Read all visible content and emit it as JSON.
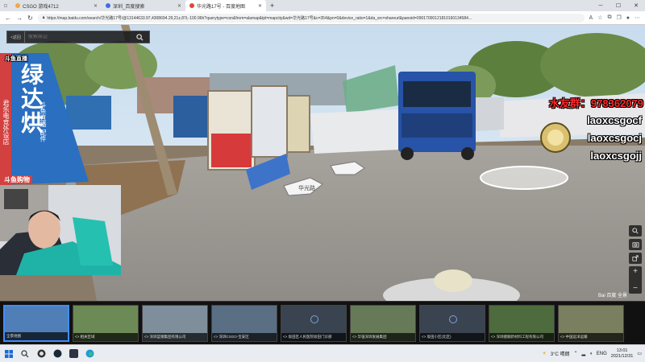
{
  "browser": {
    "tabs": [
      {
        "label": "CSGO 游戏4712",
        "color": "#f2a84a",
        "active": false
      },
      {
        "label": "深圳_百度搜索",
        "color": "#3b6fe0",
        "active": false
      },
      {
        "label": "华光路17号 - 百度地图",
        "color": "#e0453b",
        "active": true
      }
    ],
    "new_tab": "+",
    "url": "https://map.baidu.com/search/华光路17号/@13144633.97,4308694.29,21z,87t,-100.96h?querytype=con&from=alamap&tpl=mapcity&wd=华光路17号&c=354&pn=0&device_ratio=1&da_src=shareurl&panoid=09017000121810160134584..."
  },
  "map": {
    "search_back": "<返回",
    "search_placeholder": "搜索周边",
    "sign_banner": "绿色人人 无公害 健康",
    "street_sign": "华光路"
  },
  "stream": {
    "banner_top": "斗鱼直播",
    "banner_big": "绿达烘",
    "banner_side": "君乐电竞外设店",
    "banner_side2": "斗鱼直播 配件",
    "banner_label": "斗鱼购物",
    "fan_group": "水友群：978362079",
    "handles": [
      "laoxcsgocf",
      "laoxcsgocj",
      "laoxcsgojj"
    ]
  },
  "thumbnails": [
    {
      "caption": "全景地图",
      "kind": "map"
    },
    {
      "caption": "<> 相关区域",
      "kind": "photo"
    },
    {
      "caption": "<> 深圳蓝钢集团有限公司",
      "kind": "photo"
    },
    {
      "caption": "<> 深圳CSGO-宝安区",
      "kind": "photo"
    },
    {
      "caption": "<> 坂田区人民医院坂田门诊部",
      "kind": "pin"
    },
    {
      "caption": "<> 华强深圳发展集团",
      "kind": "photo"
    },
    {
      "caption": "<> 坂田小区(北区)",
      "kind": "pin"
    },
    {
      "caption": "<> 深圳捷顺新材料工程有限公司",
      "kind": "photo"
    },
    {
      "caption": "<> 中国远洋运输",
      "kind": "photo"
    }
  ],
  "map_logo": "Bai 百度 全景",
  "taskbar": {
    "weather": "3°C 晴朗",
    "lang": "ENG",
    "time": "13:01",
    "date": "2021/12/31"
  },
  "colors": {
    "accent": "#3f8cff",
    "fan_red": "#ff2a2a"
  }
}
